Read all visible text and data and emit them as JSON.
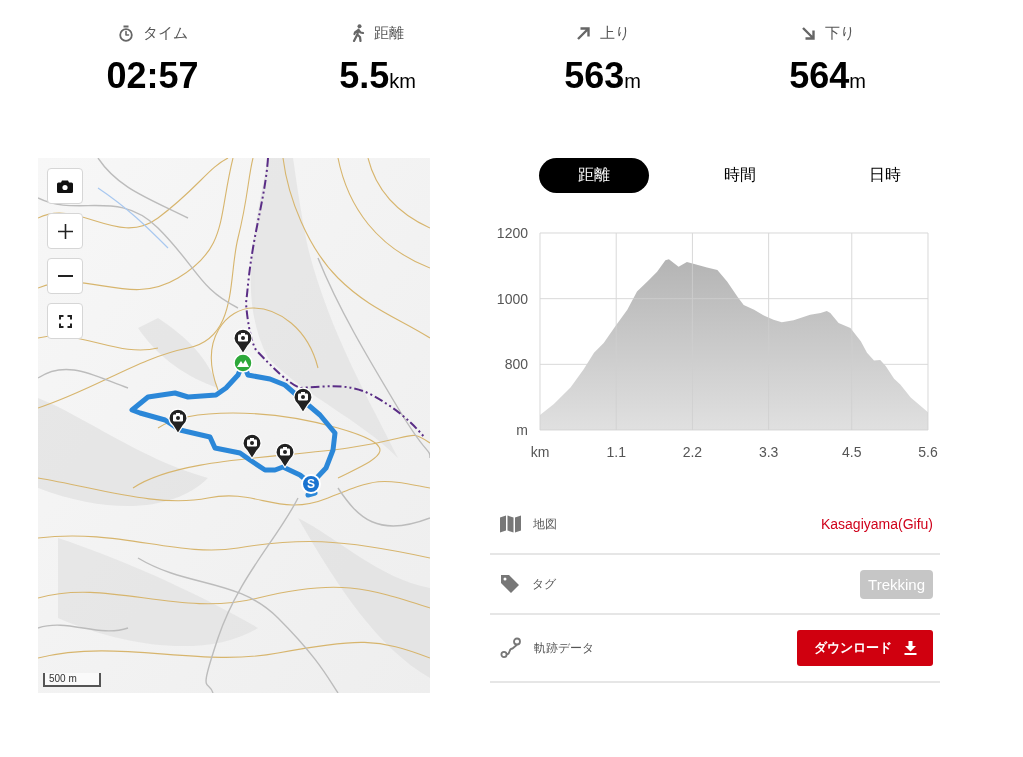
{
  "stats": [
    {
      "kind": "time",
      "label": "タイム",
      "value": "02:57"
    },
    {
      "kind": "distance",
      "label": "距離",
      "value": "5.5",
      "unit": "km"
    },
    {
      "kind": "ascent",
      "label": "上り",
      "value": "563",
      "unit": "m"
    },
    {
      "kind": "descent",
      "label": "下り",
      "value": "564",
      "unit": "m"
    }
  ],
  "map": {
    "controls": [
      {
        "kind": "camera"
      },
      {
        "kind": "zoom_in"
      },
      {
        "kind": "zoom_out"
      },
      {
        "kind": "fullscreen"
      }
    ],
    "markers": [
      {
        "kind": "photo"
      },
      {
        "kind": "summit"
      },
      {
        "kind": "photo"
      },
      {
        "kind": "photo"
      },
      {
        "kind": "photo"
      },
      {
        "kind": "photo"
      },
      {
        "kind": "start",
        "label": "S"
      }
    ],
    "scale_label": "500 m"
  },
  "chart_tabs": [
    {
      "label": "距離",
      "selected": true
    },
    {
      "label": "時間",
      "selected": false
    },
    {
      "label": "日時",
      "selected": false
    }
  ],
  "elevation": {
    "chart_data": {
      "type": "area",
      "x": [
        0,
        0.2,
        0.44,
        0.63,
        0.78,
        0.92,
        1.07,
        1.26,
        1.4,
        1.55,
        1.69,
        1.81,
        1.86,
        2.0,
        2.12,
        2.24,
        2.41,
        2.56,
        2.7,
        2.85,
        2.94,
        3.09,
        3.23,
        3.37,
        3.49,
        3.66,
        3.9,
        4.05,
        4.14,
        4.19,
        4.31,
        4.48,
        4.63,
        4.72,
        4.82,
        4.91,
        4.99,
        5.11,
        5.2,
        5.35,
        5.6
      ],
      "values": [
        646,
        679,
        729,
        785,
        835,
        865,
        911,
        966,
        1022,
        1052,
        1082,
        1117,
        1120,
        1097,
        1112,
        1105,
        1095,
        1087,
        1052,
        1006,
        981,
        966,
        949,
        936,
        928,
        934,
        951,
        956,
        962,
        956,
        926,
        911,
        870,
        835,
        812,
        813,
        795,
        756,
        739,
        699,
        654
      ],
      "xlim": [
        0,
        5.6
      ],
      "ylim": [
        600,
        1200
      ],
      "xticks": [
        {
          "value": 0,
          "label": "km"
        },
        1.1,
        2.2,
        3.3,
        4.5,
        5.6
      ],
      "yticks": [
        {
          "value": 600,
          "label": "m"
        },
        800,
        1000,
        1200
      ],
      "grid": true
    }
  },
  "details": [
    {
      "kind": "map",
      "label": "地図",
      "value": "Kasagiyama(Gifu)"
    },
    {
      "kind": "tags",
      "label": "タグ",
      "tags": [
        "Trekking"
      ]
    },
    {
      "kind": "track",
      "label": "軌跡データ",
      "action": "ダウンロード"
    }
  ]
}
